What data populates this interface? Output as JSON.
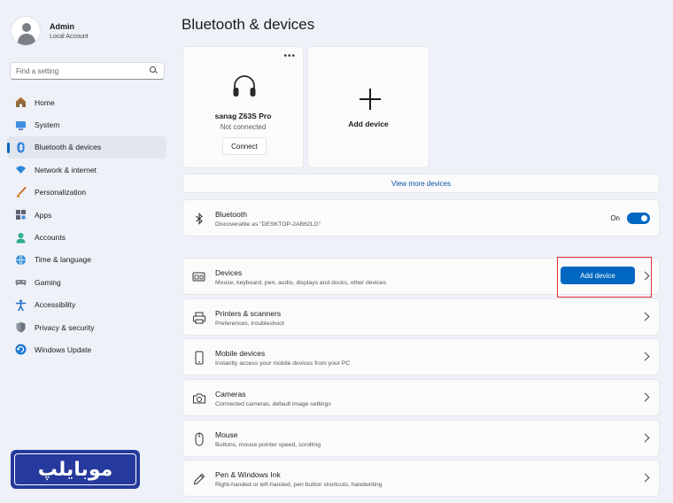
{
  "profile": {
    "name": "Admin",
    "account_type": "Local Account"
  },
  "search": {
    "placeholder": "Find a setting"
  },
  "sidebar": {
    "items": [
      {
        "label": "Home",
        "icon": "home-icon"
      },
      {
        "label": "System",
        "icon": "monitor-icon"
      },
      {
        "label": "Bluetooth & devices",
        "icon": "bluetooth-icon",
        "active": true
      },
      {
        "label": "Network & internet",
        "icon": "wifi-icon"
      },
      {
        "label": "Personalization",
        "icon": "brush-icon"
      },
      {
        "label": "Apps",
        "icon": "apps-icon"
      },
      {
        "label": "Accounts",
        "icon": "person-icon"
      },
      {
        "label": "Time & language",
        "icon": "globe-icon"
      },
      {
        "label": "Gaming",
        "icon": "gamepad-icon"
      },
      {
        "label": "Accessibility",
        "icon": "accessibility-icon"
      },
      {
        "label": "Privacy & security",
        "icon": "shield-icon"
      },
      {
        "label": "Windows Update",
        "icon": "update-icon"
      }
    ]
  },
  "main": {
    "title": "Bluetooth & devices",
    "device_card": {
      "name": "sanag Z63S Pro",
      "status": "Not connected",
      "connect_label": "Connect",
      "more_label": "•••",
      "icon": "headphones-icon"
    },
    "add_card": {
      "label": "Add device",
      "icon": "plus-icon"
    },
    "view_more": "View more devices",
    "bluetooth": {
      "title": "Bluetooth",
      "subtitle": "Discoverable as \"DESKTOP-2AB62LG\"",
      "toggle_label": "On",
      "toggle_on": true
    },
    "rows": [
      {
        "title": "Devices",
        "subtitle": "Mouse, keyboard, pen, audio, displays and docks, other devices",
        "icon": "devices-icon",
        "button_label": "Add device"
      },
      {
        "title": "Printers & scanners",
        "subtitle": "Preferences, troubleshoot",
        "icon": "printer-icon"
      },
      {
        "title": "Mobile devices",
        "subtitle": "Instantly access your mobile devices from your PC",
        "icon": "phone-icon"
      },
      {
        "title": "Cameras",
        "subtitle": "Connected cameras, default image settings",
        "icon": "camera-icon"
      },
      {
        "title": "Mouse",
        "subtitle": "Buttons, mouse pointer speed, scrolling",
        "icon": "mouse-icon"
      },
      {
        "title": "Pen & Windows Ink",
        "subtitle": "Right-handed or left-handed, pen button shortcuts, handwriting",
        "icon": "pen-icon"
      }
    ]
  },
  "watermark": {
    "text": "موبایلپ"
  },
  "colors": {
    "accent": "#0067c0",
    "highlight": "#e03131",
    "background": "#eef1f7",
    "card": "#fbfbfc",
    "link": "#0a4fa3",
    "watermark": "#253a9c"
  }
}
